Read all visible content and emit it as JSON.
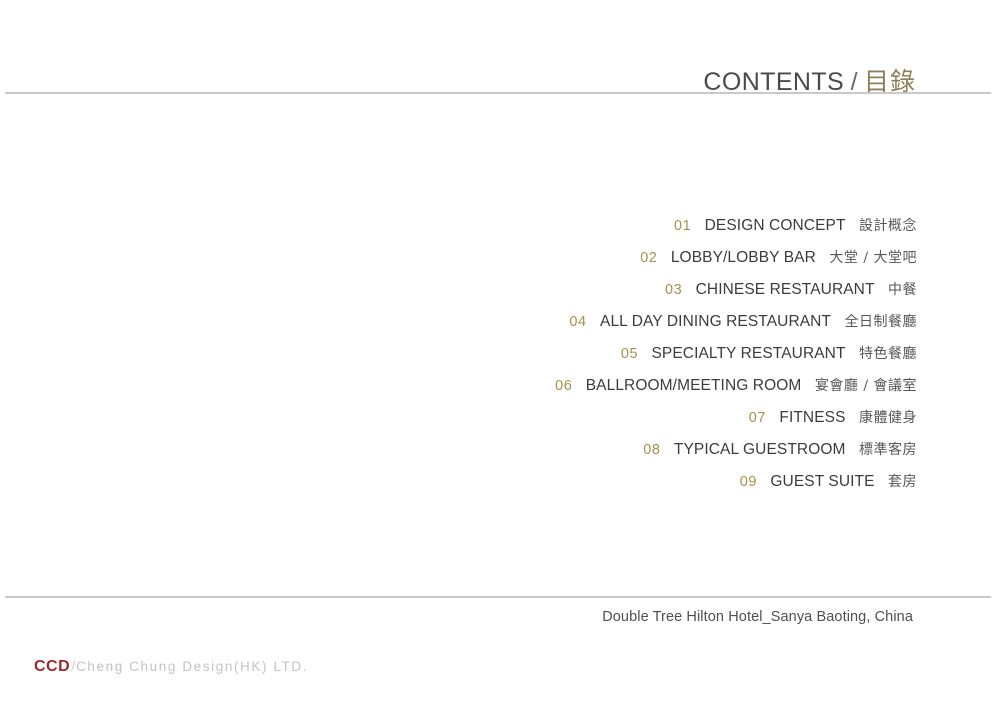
{
  "header": {
    "english_title": "CONTENTS",
    "separator": "/",
    "chinese_title": "目錄"
  },
  "contents": {
    "items": [
      {
        "number": "01",
        "english": "DESIGN CONCEPT",
        "chinese": "設計概念"
      },
      {
        "number": "02",
        "english": "LOBBY/LOBBY BAR",
        "chinese": "大堂 / 大堂吧"
      },
      {
        "number": "03",
        "english": "CHINESE RESTAURANT",
        "chinese": "中餐"
      },
      {
        "number": "04",
        "english": "ALL DAY DINING RESTAURANT",
        "chinese": "全日制餐廳"
      },
      {
        "number": "05",
        "english": "SPECIALTY RESTAURANT",
        "chinese": "特色餐廳"
      },
      {
        "number": "06",
        "english": "BALLROOM/MEETING ROOM",
        "chinese": "宴會廳 / 會議室"
      },
      {
        "number": "07",
        "english": "FITNESS",
        "chinese": "康體健身"
      },
      {
        "number": "08",
        "english": "TYPICAL GUESTROOM",
        "chinese": "標準客房"
      },
      {
        "number": "09",
        "english": "GUEST SUITE",
        "chinese": "套房"
      }
    ]
  },
  "footer": {
    "project_caption": "Double Tree Hilton Hotel_Sanya Baoting, China",
    "brand_mark": "CCD",
    "brand_slash": "/",
    "brand_name": "Cheng Chung Design(HK) LTD."
  },
  "colors": {
    "accent_gold": "#a3924f",
    "header_chinese": "#8d8058",
    "brand_red": "#9c2a2c",
    "rule": "#c9c9c9",
    "background": "#ffffff"
  }
}
